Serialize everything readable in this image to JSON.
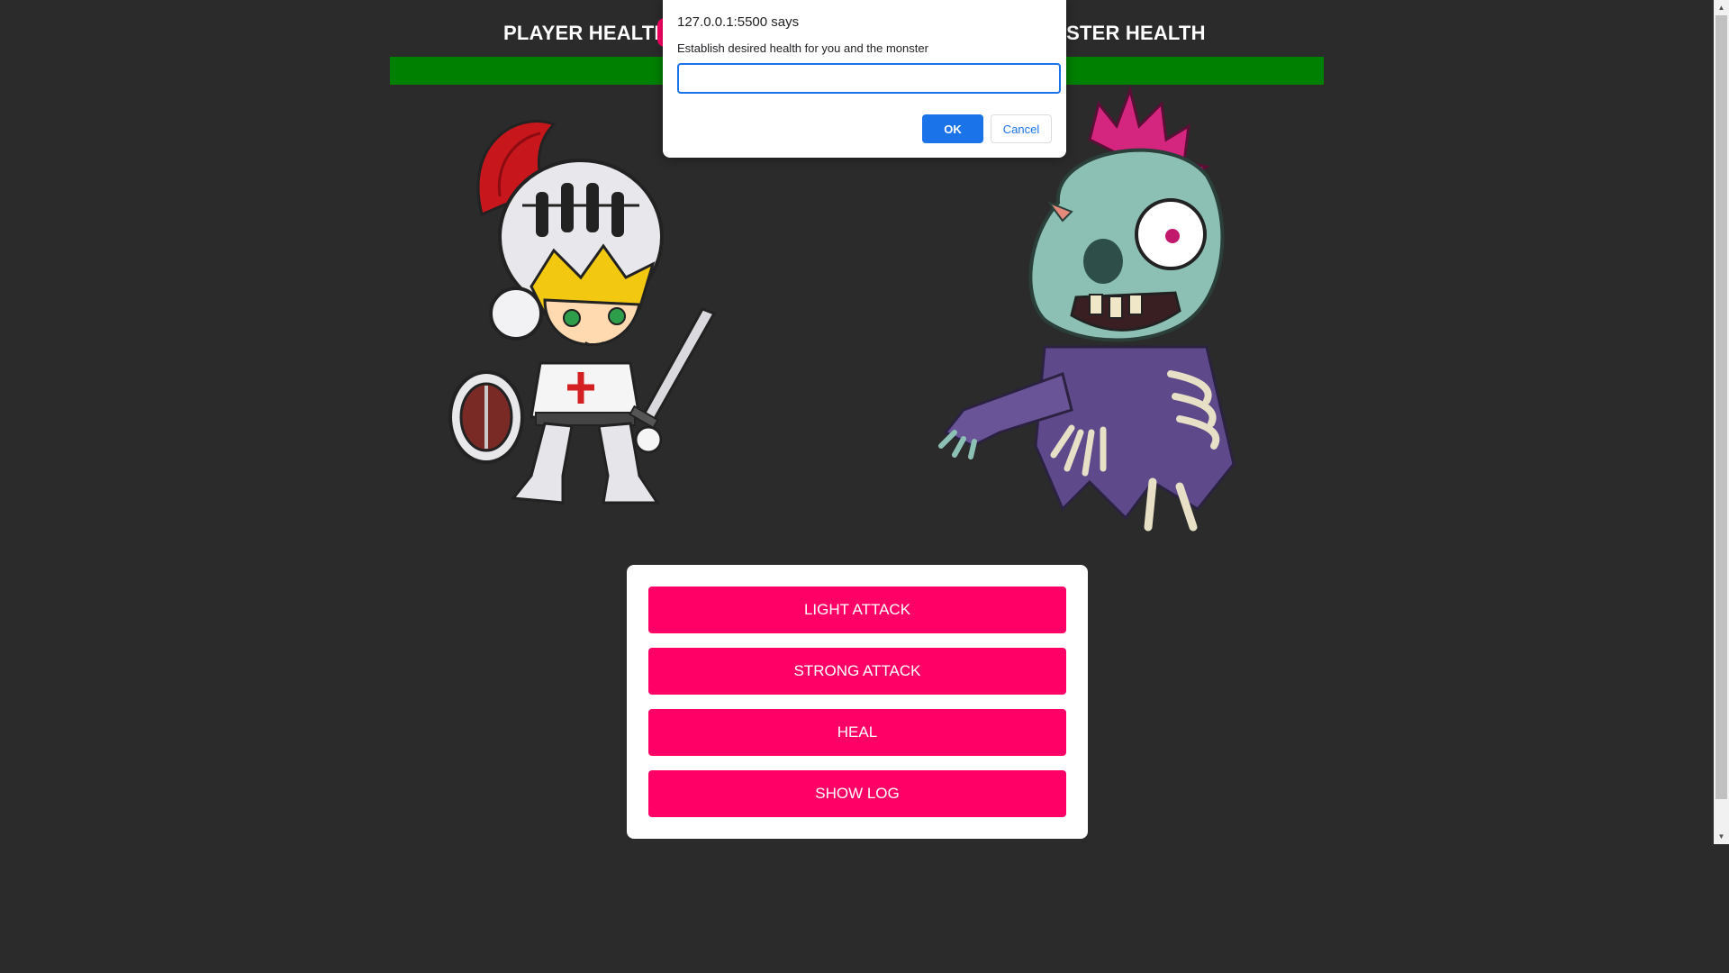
{
  "header": {
    "player_health_label": "PLAYER HEALTH",
    "monster_health_label": "NSTER HEALTH",
    "health_fraction": 1.0,
    "health_color": "#008000"
  },
  "controls": {
    "light_attack": "LIGHT ATTACK",
    "strong_attack": "STRONG ATTACK",
    "heal": "HEAL",
    "show_log": "SHOW LOG",
    "button_color": "#ff0066"
  },
  "characters": {
    "player_icon": "knight-image",
    "monster_icon": "zombie-image"
  },
  "dialog": {
    "title": "127.0.0.1:5500 says",
    "message": "Establish desired health for you and the monster",
    "input_value": "",
    "ok_label": "OK",
    "cancel_label": "Cancel",
    "accent_color": "#1a73e8"
  }
}
